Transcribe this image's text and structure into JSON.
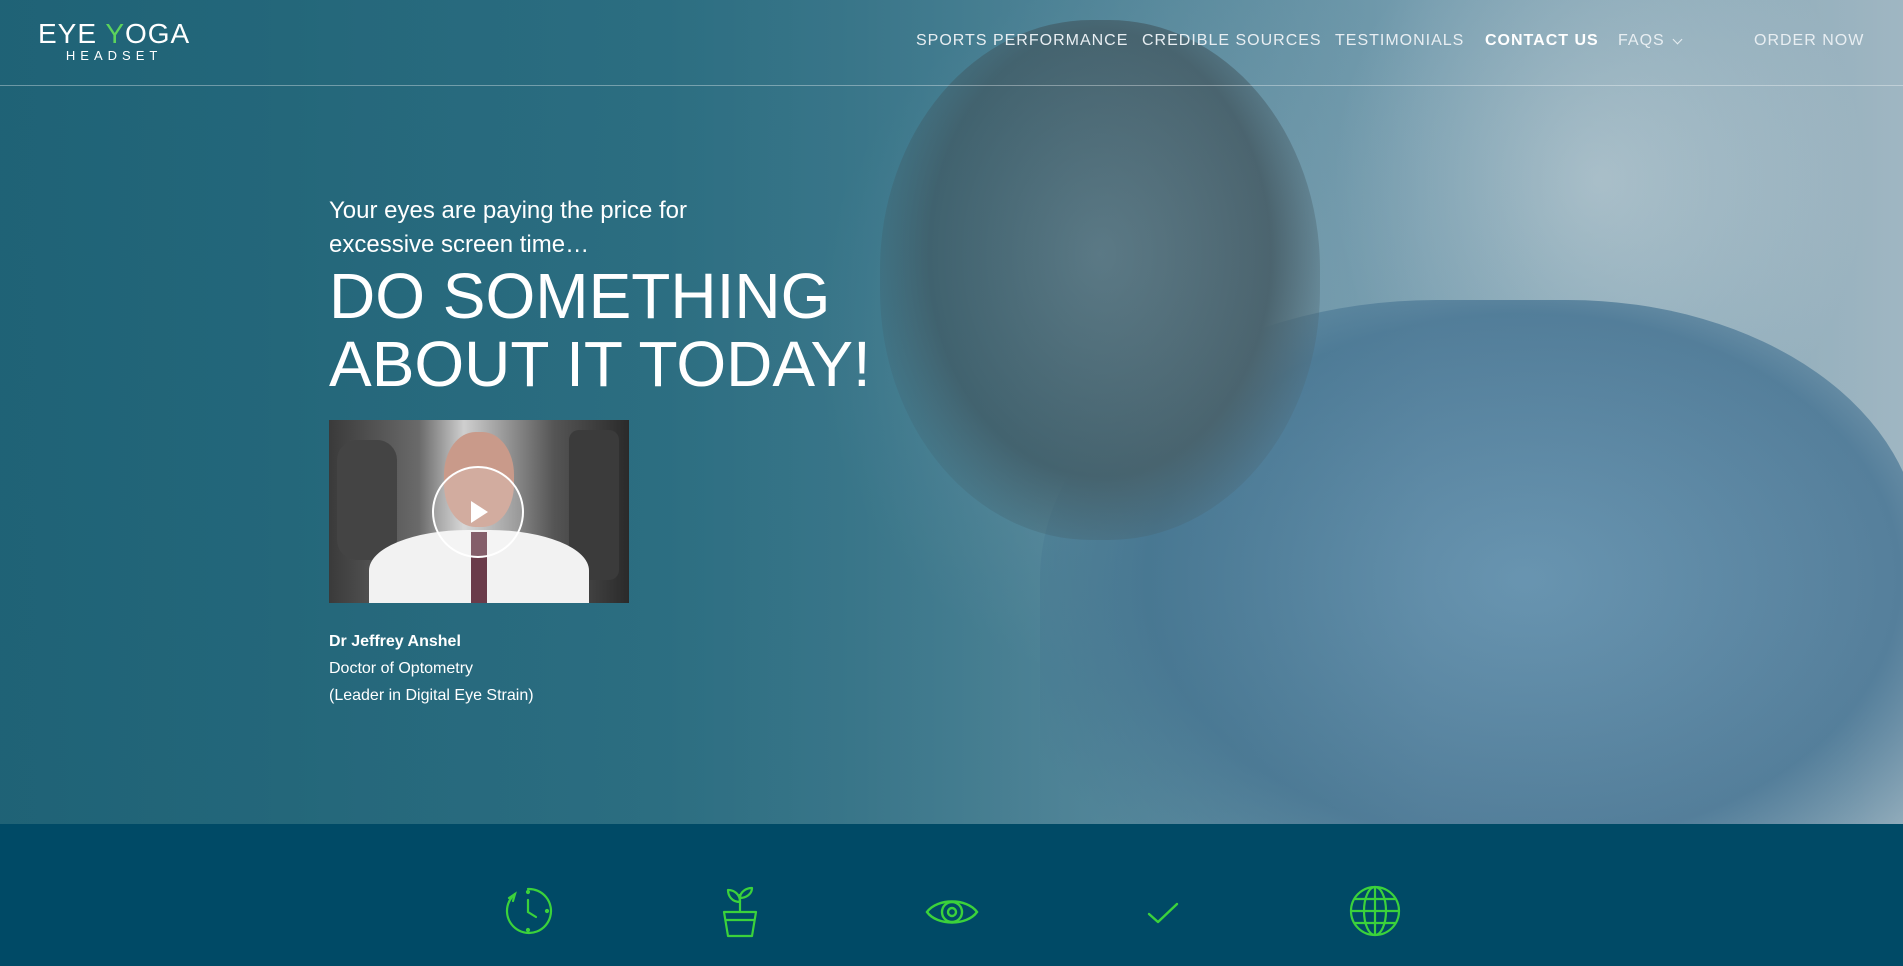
{
  "brand": {
    "logo_main_a": "EYE ",
    "logo_main_b": "Y",
    "logo_main_c": "OGA",
    "logo_sub": "HEADSET",
    "accent_color": "#5cd35c"
  },
  "nav": {
    "items": [
      "SPORTS PERFORMANCE",
      "CREDIBLE SOURCES",
      "TESTIMONIALS",
      "CONTACT US",
      "FAQS"
    ],
    "cta": "ORDER NOW"
  },
  "hero": {
    "tagline": "Your eyes are paying the price for excessive screen time…",
    "headline_line1": "DO SOMETHING",
    "headline_line2": "ABOUT IT TODAY!",
    "video": {
      "play_icon": "play-icon"
    },
    "doctor": {
      "name": "Dr Jeffrey Anshel",
      "title": "Doctor of Optometry",
      "note": "(Leader in Digital Eye Strain)"
    }
  },
  "features": {
    "icons": [
      "clock-refresh-icon",
      "plant-pot-icon",
      "eye-icon",
      "checkmark-icon",
      "globe-icon"
    ],
    "icon_color": "#3bd23b",
    "band_color": "#004a66"
  }
}
